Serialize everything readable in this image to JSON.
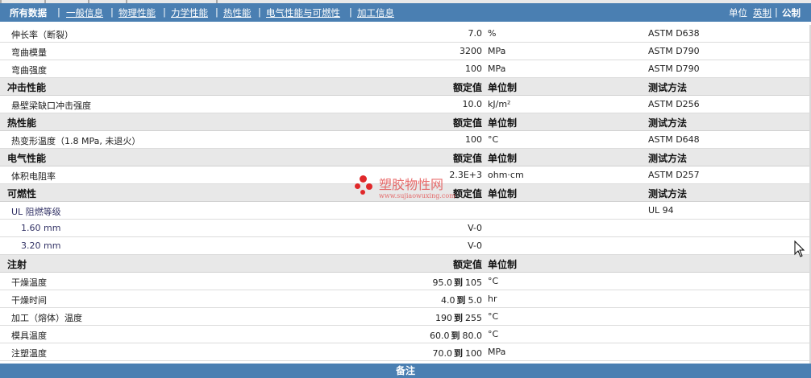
{
  "nav": {
    "tabs": [
      {
        "label": "所有数据",
        "active": true
      },
      {
        "label": "一般信息",
        "active": false
      },
      {
        "label": "物理性能",
        "active": false
      },
      {
        "label": "力学性能",
        "active": false
      },
      {
        "label": "热性能",
        "active": false
      },
      {
        "label": "电气性能与可燃性",
        "active": false
      },
      {
        "label": "加工信息",
        "active": false
      }
    ],
    "separator": "|",
    "unit_label": "单位",
    "unit_imperial": "英制",
    "unit_metric": "公制"
  },
  "rows": [
    {
      "type": "data",
      "name": "伸长率（断裂）",
      "value": "7.0",
      "unit": "%",
      "method": "ASTM D638"
    },
    {
      "type": "data",
      "name": "弯曲模量",
      "value": "3200",
      "unit": "MPa",
      "method": "ASTM D790"
    },
    {
      "type": "data",
      "name": "弯曲强度",
      "value": "100",
      "unit": "MPa",
      "method": "ASTM D790"
    },
    {
      "type": "header",
      "name": "冲击性能",
      "value": "额定值",
      "unit": "单位制",
      "method": "测试方法"
    },
    {
      "type": "data",
      "name": "悬壁梁缺口冲击强度",
      "value": "10.0",
      "unit": "kJ/m²",
      "method": "ASTM D256"
    },
    {
      "type": "header",
      "name": "热性能",
      "value": "额定值",
      "unit": "单位制",
      "method": "测试方法"
    },
    {
      "type": "data",
      "name": "热变形温度（1.8 MPa, 未退火）",
      "value": "100",
      "unit": "°C",
      "method": "ASTM D648"
    },
    {
      "type": "header",
      "name": "电气性能",
      "value": "额定值",
      "unit": "单位制",
      "method": "测试方法"
    },
    {
      "type": "data",
      "name": "体积电阻率",
      "value": "2.3E+3",
      "unit": "ohm·cm",
      "method": "ASTM D257"
    },
    {
      "type": "header",
      "name": "可燃性",
      "value": "额定值",
      "unit": "单位制",
      "method": "测试方法"
    },
    {
      "type": "data",
      "name": "UL 阻燃等级",
      "value": "",
      "unit": "",
      "method": "UL 94",
      "style": "link"
    },
    {
      "type": "data",
      "name": "1.60 mm",
      "value": "V-0",
      "unit": "",
      "method": "",
      "style": "indent2"
    },
    {
      "type": "data",
      "name": "3.20 mm",
      "value": "V-0",
      "unit": "",
      "method": "",
      "style": "indent2"
    },
    {
      "type": "header",
      "name": "注射",
      "value": "额定值",
      "unit": "单位制",
      "method": ""
    },
    {
      "type": "range",
      "name": "干燥温度",
      "low": "95.0",
      "to": "到",
      "high": "105",
      "unit": "°C",
      "method": ""
    },
    {
      "type": "range",
      "name": "干燥时间",
      "low": "4.0",
      "to": "到",
      "high": "5.0",
      "unit": "hr",
      "method": ""
    },
    {
      "type": "range",
      "name": "加工（熔体）温度",
      "low": "190",
      "to": "到",
      "high": "255",
      "unit": "°C",
      "method": ""
    },
    {
      "type": "range",
      "name": "模具温度",
      "low": "60.0",
      "to": "到",
      "high": "80.0",
      "unit": "°C",
      "method": ""
    },
    {
      "type": "range",
      "name": "注塑温度",
      "low": "70.0",
      "to": "到",
      "high": "100",
      "unit": "MPa",
      "method": ""
    }
  ],
  "footer": {
    "label": "备注"
  },
  "watermark": {
    "title": "塑胶物性网",
    "url": "www.sujiaowuxing.com"
  },
  "colors": {
    "nav_bg": "#4a7fb2",
    "header_row_bg": "#e8e8e8",
    "watermark": "#e0282a"
  }
}
